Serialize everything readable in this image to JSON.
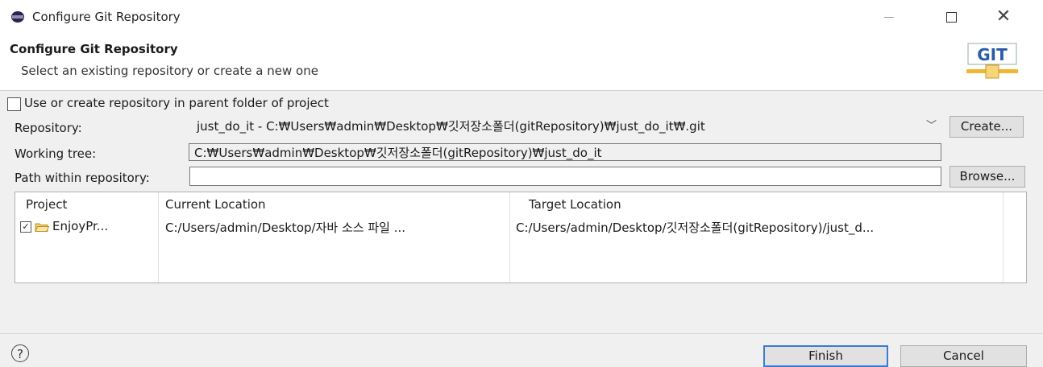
{
  "window": {
    "title": "Configure Git Repository",
    "icons": [
      "eclipse-icon",
      "minimize-icon",
      "maximize-icon",
      "close-icon"
    ]
  },
  "header": {
    "title": "Configure Git Repository",
    "description": "Select an existing repository or create a new one",
    "logo_text": "GIT"
  },
  "form": {
    "use_parent_label": "Use or create repository in parent folder of project",
    "use_parent_checked": false,
    "repository_label": "Repository:",
    "repository_value": "just_do_it - C:₩Users₩admin₩Desktop₩깃저장소폴더(gitRepository)₩just_do_it₩.git",
    "create_label": "Create...",
    "working_tree_label": "Working tree:",
    "working_tree_value": "C:₩Users₩admin₩Desktop₩깃저장소폴더(gitRepository)₩just_do_it",
    "path_label": "Path within repository:",
    "path_value": "",
    "browse_label": "Browse..."
  },
  "table": {
    "columns": [
      "Project",
      "Current Location",
      "Target Location"
    ],
    "rows": [
      {
        "checked": true,
        "project": "EnjoyPr...",
        "current": "C:/Users/admin/Desktop/자바 소스 파일 ...",
        "target": "C:/Users/admin/Desktop/깃저장소폴더(gitRepository)/just_d..."
      }
    ]
  },
  "footer": {
    "help_symbol": "?",
    "finish_label": "Finish",
    "cancel_label": "Cancel"
  },
  "colors": {
    "accent": "#3b7bd1",
    "dialog_bg": "#f0f0f0"
  }
}
